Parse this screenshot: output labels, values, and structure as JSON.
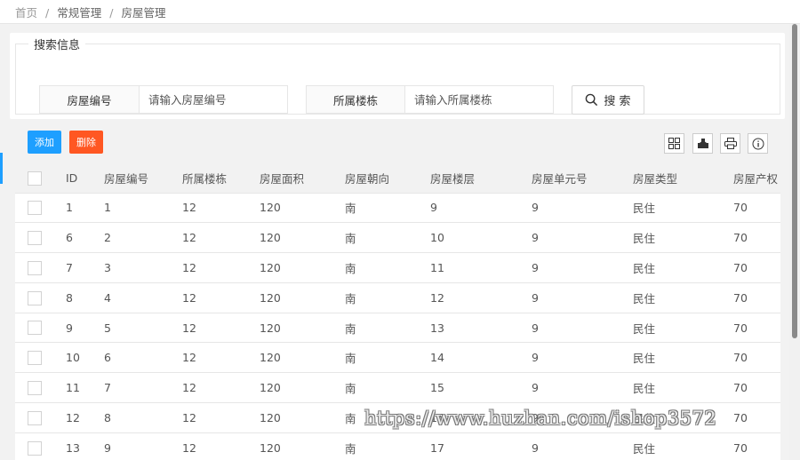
{
  "breadcrumb": [
    "首页",
    "常规管理",
    "房屋管理"
  ],
  "search": {
    "legend": "搜索信息",
    "fields": [
      {
        "label": "房屋编号",
        "placeholder": "请输入房屋编号",
        "value": ""
      },
      {
        "label": "所属楼栋",
        "placeholder": "请输入所属楼栋",
        "value": ""
      }
    ],
    "button_label": "搜 索"
  },
  "toolbar": {
    "add_label": "添加",
    "delete_label": "删除",
    "icons": [
      "columns-icon",
      "export-icon",
      "print-icon",
      "info-icon"
    ]
  },
  "table": {
    "columns": [
      "ID",
      "房屋编号",
      "所属楼栋",
      "房屋面积",
      "房屋朝向",
      "房屋楼层",
      "房屋单元号",
      "房屋类型",
      "房屋产权"
    ],
    "rows": [
      [
        "1",
        "1",
        "12",
        "120",
        "南",
        "9",
        "9",
        "民住",
        "70"
      ],
      [
        "6",
        "2",
        "12",
        "120",
        "南",
        "10",
        "9",
        "民住",
        "70"
      ],
      [
        "7",
        "3",
        "12",
        "120",
        "南",
        "11",
        "9",
        "民住",
        "70"
      ],
      [
        "8",
        "4",
        "12",
        "120",
        "南",
        "12",
        "9",
        "民住",
        "70"
      ],
      [
        "9",
        "5",
        "12",
        "120",
        "南",
        "13",
        "9",
        "民住",
        "70"
      ],
      [
        "10",
        "6",
        "12",
        "120",
        "南",
        "14",
        "9",
        "民住",
        "70"
      ],
      [
        "11",
        "7",
        "12",
        "120",
        "南",
        "15",
        "9",
        "民住",
        "70"
      ],
      [
        "12",
        "8",
        "12",
        "120",
        "南",
        "16",
        "9",
        "民住",
        "70"
      ],
      [
        "13",
        "9",
        "12",
        "120",
        "南",
        "17",
        "9",
        "民住",
        "70"
      ]
    ]
  },
  "watermark": "https://www.huzhan.com/ishop3572",
  "colors": {
    "primary": "#1e9fff",
    "danger": "#ff5722",
    "header_bg": "#f2f2f2"
  }
}
